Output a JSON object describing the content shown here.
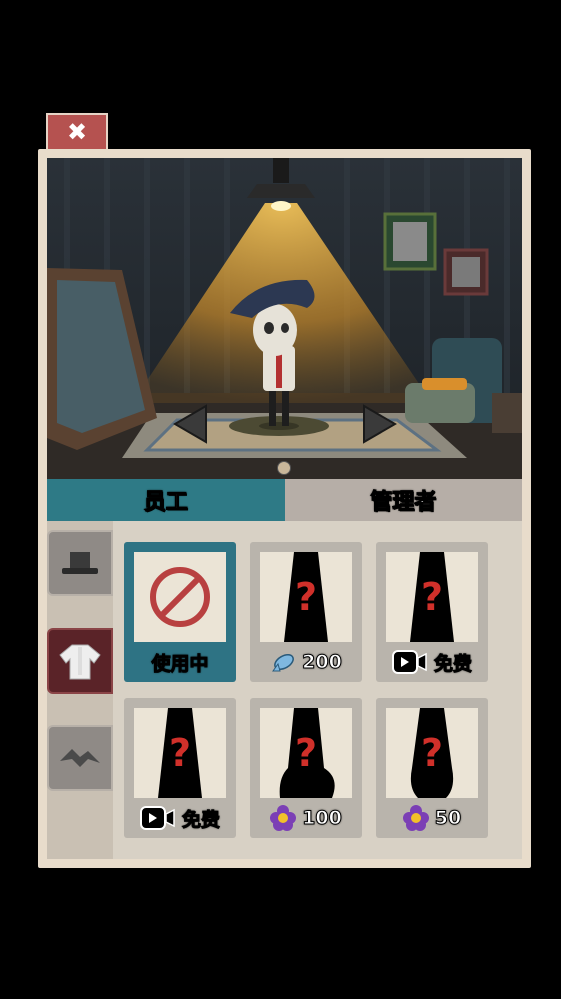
{
  "close_button": {
    "icon": "crossed-tools-icon",
    "glyph": "✖"
  },
  "tabs": [
    {
      "label": "员工",
      "active": true
    },
    {
      "label": "管理者",
      "active": false
    }
  ],
  "category_tabs": [
    {
      "name": "hat",
      "icon": "hat-icon",
      "active": false
    },
    {
      "name": "shirt",
      "icon": "shirt-icon",
      "active": true
    },
    {
      "name": "shoes",
      "icon": "shoes-icon",
      "active": false
    }
  ],
  "items": [
    {
      "status": "使用中",
      "selected": true,
      "icon": "none-icon"
    },
    {
      "price": "200",
      "currency_icon": "fish-icon",
      "locked": true
    },
    {
      "price": "免费",
      "currency_icon": "video-ad-icon",
      "locked": true
    },
    {
      "price": "免费",
      "currency_icon": "video-ad-icon",
      "locked": true
    },
    {
      "price": "100",
      "currency_icon": "flower-icon",
      "locked": true
    },
    {
      "price": "50",
      "currency_icon": "flower-icon",
      "locked": true
    }
  ],
  "colors": {
    "accent": "#2e7a86",
    "close": "#b55250",
    "panel": "#e8dccb"
  }
}
